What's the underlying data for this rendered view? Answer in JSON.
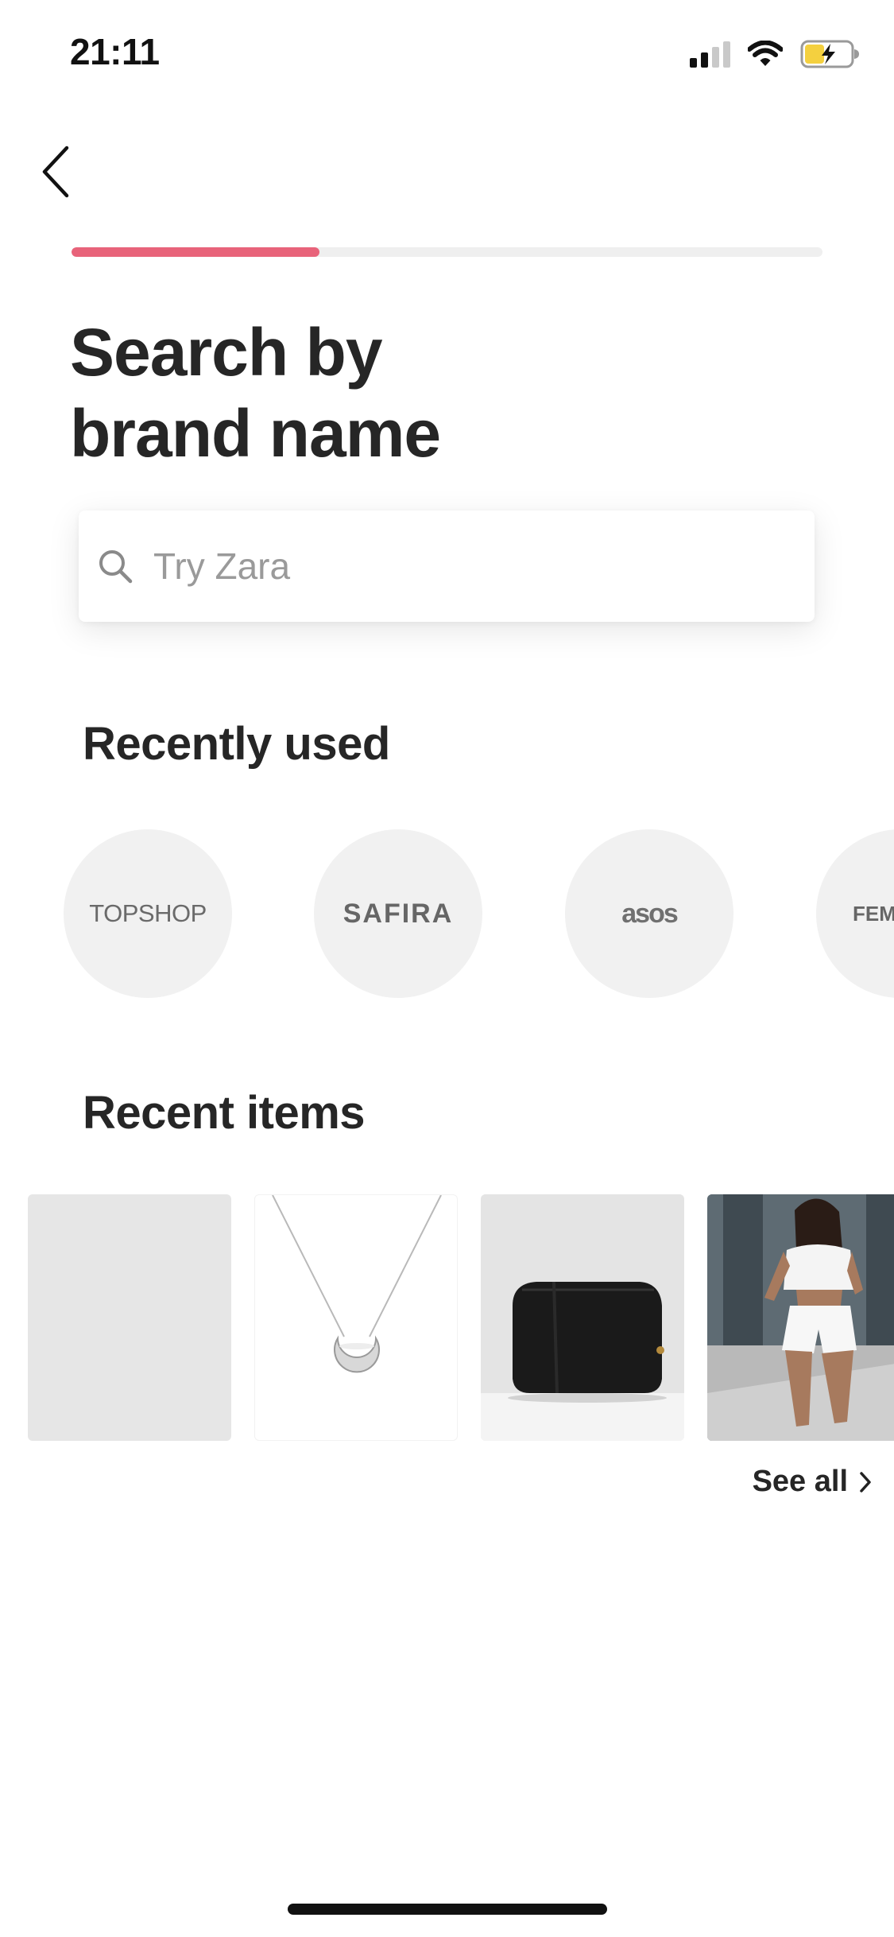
{
  "status_bar": {
    "time": "21:11",
    "icons": [
      "signal-icon",
      "wifi-icon",
      "battery-charging-icon"
    ],
    "battery_color": "#f4d03f"
  },
  "navigation": {
    "back_icon": "chevron-left-icon"
  },
  "progress": {
    "fraction": 0.33,
    "accent_color": "#e8637a"
  },
  "page": {
    "title_line1": "Search by",
    "title_line2": "brand name"
  },
  "search": {
    "icon": "search-icon",
    "value": "",
    "placeholder": "Try Zara"
  },
  "recently_used": {
    "heading": "Recently used",
    "brands": [
      {
        "label": "TOPSHOP"
      },
      {
        "label": "SAFIRA"
      },
      {
        "label": "asos"
      },
      {
        "label": "FEMM"
      }
    ]
  },
  "recent_items": {
    "heading": "Recent items",
    "items": [
      {
        "kind": "placeholder"
      },
      {
        "kind": "crescent-necklace"
      },
      {
        "kind": "black-crossbody-bag"
      },
      {
        "kind": "white-two-piece-outfit"
      }
    ],
    "see_all_label": "See all",
    "see_all_icon": "chevron-right-icon"
  }
}
